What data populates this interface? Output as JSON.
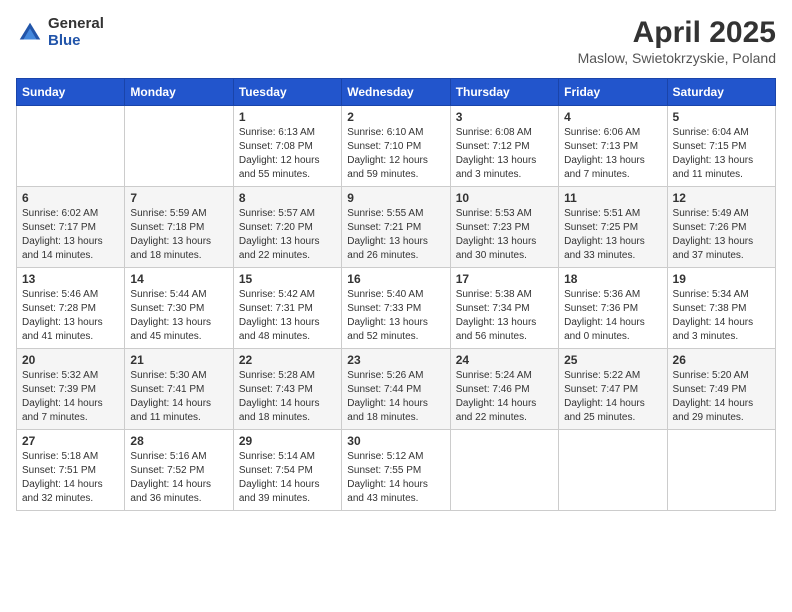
{
  "logo": {
    "general": "General",
    "blue": "Blue"
  },
  "header": {
    "title": "April 2025",
    "subtitle": "Maslow, Swietokrzyskie, Poland"
  },
  "weekdays": [
    "Sunday",
    "Monday",
    "Tuesday",
    "Wednesday",
    "Thursday",
    "Friday",
    "Saturday"
  ],
  "weeks": [
    [
      {
        "day": "",
        "sunrise": "",
        "sunset": "",
        "daylight": ""
      },
      {
        "day": "",
        "sunrise": "",
        "sunset": "",
        "daylight": ""
      },
      {
        "day": "1",
        "sunrise": "Sunrise: 6:13 AM",
        "sunset": "Sunset: 7:08 PM",
        "daylight": "Daylight: 12 hours and 55 minutes."
      },
      {
        "day": "2",
        "sunrise": "Sunrise: 6:10 AM",
        "sunset": "Sunset: 7:10 PM",
        "daylight": "Daylight: 12 hours and 59 minutes."
      },
      {
        "day": "3",
        "sunrise": "Sunrise: 6:08 AM",
        "sunset": "Sunset: 7:12 PM",
        "daylight": "Daylight: 13 hours and 3 minutes."
      },
      {
        "day": "4",
        "sunrise": "Sunrise: 6:06 AM",
        "sunset": "Sunset: 7:13 PM",
        "daylight": "Daylight: 13 hours and 7 minutes."
      },
      {
        "day": "5",
        "sunrise": "Sunrise: 6:04 AM",
        "sunset": "Sunset: 7:15 PM",
        "daylight": "Daylight: 13 hours and 11 minutes."
      }
    ],
    [
      {
        "day": "6",
        "sunrise": "Sunrise: 6:02 AM",
        "sunset": "Sunset: 7:17 PM",
        "daylight": "Daylight: 13 hours and 14 minutes."
      },
      {
        "day": "7",
        "sunrise": "Sunrise: 5:59 AM",
        "sunset": "Sunset: 7:18 PM",
        "daylight": "Daylight: 13 hours and 18 minutes."
      },
      {
        "day": "8",
        "sunrise": "Sunrise: 5:57 AM",
        "sunset": "Sunset: 7:20 PM",
        "daylight": "Daylight: 13 hours and 22 minutes."
      },
      {
        "day": "9",
        "sunrise": "Sunrise: 5:55 AM",
        "sunset": "Sunset: 7:21 PM",
        "daylight": "Daylight: 13 hours and 26 minutes."
      },
      {
        "day": "10",
        "sunrise": "Sunrise: 5:53 AM",
        "sunset": "Sunset: 7:23 PM",
        "daylight": "Daylight: 13 hours and 30 minutes."
      },
      {
        "day": "11",
        "sunrise": "Sunrise: 5:51 AM",
        "sunset": "Sunset: 7:25 PM",
        "daylight": "Daylight: 13 hours and 33 minutes."
      },
      {
        "day": "12",
        "sunrise": "Sunrise: 5:49 AM",
        "sunset": "Sunset: 7:26 PM",
        "daylight": "Daylight: 13 hours and 37 minutes."
      }
    ],
    [
      {
        "day": "13",
        "sunrise": "Sunrise: 5:46 AM",
        "sunset": "Sunset: 7:28 PM",
        "daylight": "Daylight: 13 hours and 41 minutes."
      },
      {
        "day": "14",
        "sunrise": "Sunrise: 5:44 AM",
        "sunset": "Sunset: 7:30 PM",
        "daylight": "Daylight: 13 hours and 45 minutes."
      },
      {
        "day": "15",
        "sunrise": "Sunrise: 5:42 AM",
        "sunset": "Sunset: 7:31 PM",
        "daylight": "Daylight: 13 hours and 48 minutes."
      },
      {
        "day": "16",
        "sunrise": "Sunrise: 5:40 AM",
        "sunset": "Sunset: 7:33 PM",
        "daylight": "Daylight: 13 hours and 52 minutes."
      },
      {
        "day": "17",
        "sunrise": "Sunrise: 5:38 AM",
        "sunset": "Sunset: 7:34 PM",
        "daylight": "Daylight: 13 hours and 56 minutes."
      },
      {
        "day": "18",
        "sunrise": "Sunrise: 5:36 AM",
        "sunset": "Sunset: 7:36 PM",
        "daylight": "Daylight: 14 hours and 0 minutes."
      },
      {
        "day": "19",
        "sunrise": "Sunrise: 5:34 AM",
        "sunset": "Sunset: 7:38 PM",
        "daylight": "Daylight: 14 hours and 3 minutes."
      }
    ],
    [
      {
        "day": "20",
        "sunrise": "Sunrise: 5:32 AM",
        "sunset": "Sunset: 7:39 PM",
        "daylight": "Daylight: 14 hours and 7 minutes."
      },
      {
        "day": "21",
        "sunrise": "Sunrise: 5:30 AM",
        "sunset": "Sunset: 7:41 PM",
        "daylight": "Daylight: 14 hours and 11 minutes."
      },
      {
        "day": "22",
        "sunrise": "Sunrise: 5:28 AM",
        "sunset": "Sunset: 7:43 PM",
        "daylight": "Daylight: 14 hours and 18 minutes."
      },
      {
        "day": "23",
        "sunrise": "Sunrise: 5:26 AM",
        "sunset": "Sunset: 7:44 PM",
        "daylight": "Daylight: 14 hours and 18 minutes."
      },
      {
        "day": "24",
        "sunrise": "Sunrise: 5:24 AM",
        "sunset": "Sunset: 7:46 PM",
        "daylight": "Daylight: 14 hours and 22 minutes."
      },
      {
        "day": "25",
        "sunrise": "Sunrise: 5:22 AM",
        "sunset": "Sunset: 7:47 PM",
        "daylight": "Daylight: 14 hours and 25 minutes."
      },
      {
        "day": "26",
        "sunrise": "Sunrise: 5:20 AM",
        "sunset": "Sunset: 7:49 PM",
        "daylight": "Daylight: 14 hours and 29 minutes."
      }
    ],
    [
      {
        "day": "27",
        "sunrise": "Sunrise: 5:18 AM",
        "sunset": "Sunset: 7:51 PM",
        "daylight": "Daylight: 14 hours and 32 minutes."
      },
      {
        "day": "28",
        "sunrise": "Sunrise: 5:16 AM",
        "sunset": "Sunset: 7:52 PM",
        "daylight": "Daylight: 14 hours and 36 minutes."
      },
      {
        "day": "29",
        "sunrise": "Sunrise: 5:14 AM",
        "sunset": "Sunset: 7:54 PM",
        "daylight": "Daylight: 14 hours and 39 minutes."
      },
      {
        "day": "30",
        "sunrise": "Sunrise: 5:12 AM",
        "sunset": "Sunset: 7:55 PM",
        "daylight": "Daylight: 14 hours and 43 minutes."
      },
      {
        "day": "",
        "sunrise": "",
        "sunset": "",
        "daylight": ""
      },
      {
        "day": "",
        "sunrise": "",
        "sunset": "",
        "daylight": ""
      },
      {
        "day": "",
        "sunrise": "",
        "sunset": "",
        "daylight": ""
      }
    ]
  ]
}
